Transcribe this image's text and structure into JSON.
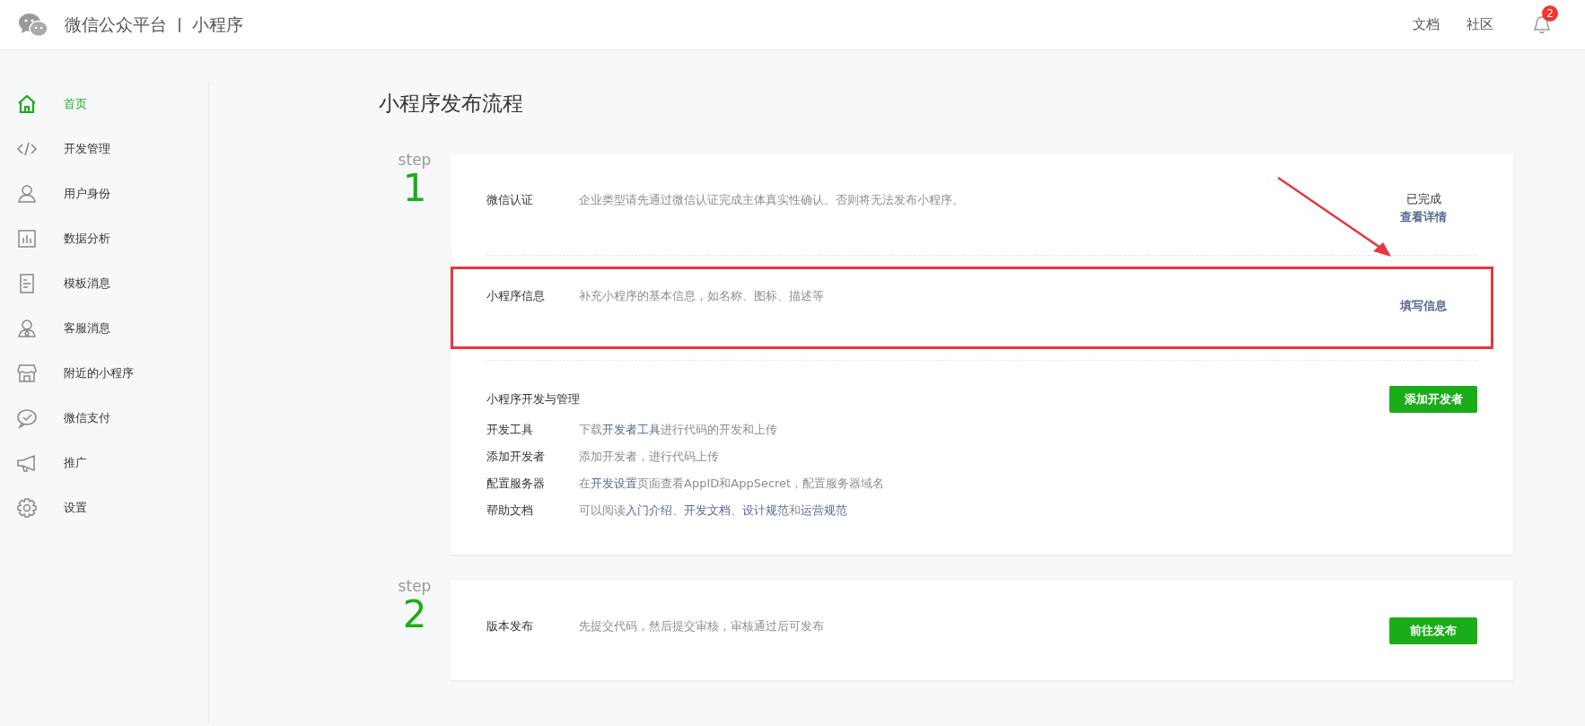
{
  "header": {
    "brand": "微信公众平台",
    "section": "小程序",
    "links": [
      "文档",
      "社区"
    ],
    "notification_count": "2"
  },
  "sidebar": {
    "items": [
      {
        "label": "首页",
        "selected": true
      },
      {
        "label": "开发管理",
        "selected": false
      },
      {
        "label": "用户身份",
        "selected": false
      },
      {
        "label": "数据分析",
        "selected": false
      },
      {
        "label": "模板消息",
        "selected": false
      },
      {
        "label": "客服消息",
        "selected": false
      },
      {
        "label": "附近的小程序",
        "selected": false
      },
      {
        "label": "微信支付",
        "selected": false
      },
      {
        "label": "推广",
        "selected": false
      },
      {
        "label": "设置",
        "selected": false
      }
    ]
  },
  "page_title": "小程序发布流程",
  "steps": [
    {
      "step_label": "step",
      "number": "1",
      "rows": [
        {
          "kind": "task",
          "label": "微信认证",
          "description": "企业类型请先通过微信认证完成主体真实性确认。否则将无法发布小程序。",
          "status": "已完成",
          "link": "查看详情"
        },
        {
          "kind": "task",
          "label": "小程序信息",
          "description": "补充小程序的基本信息，如名称、图标、描述等",
          "link": "填写信息",
          "highlighted": true
        },
        {
          "kind": "section",
          "title": "小程序开发与管理",
          "button": "添加开发者",
          "items": [
            {
              "label": "开发工具",
              "parts": [
                {
                  "text": "下载"
                },
                {
                  "link": "开发者工具"
                },
                {
                  "text": "进行代码的开发和上传"
                }
              ]
            },
            {
              "label": "添加开发者",
              "parts": [
                {
                  "text": "添加开发者，进行代码上传"
                }
              ]
            },
            {
              "label": "配置服务器",
              "parts": [
                {
                  "text": "在"
                },
                {
                  "link": "开发设置"
                },
                {
                  "text": "页面查看AppID和AppSecret，配置服务器域名"
                }
              ]
            },
            {
              "label": "帮助文档",
              "parts": [
                {
                  "text": "可以阅读"
                },
                {
                  "link": "入门介绍"
                },
                {
                  "text": "、"
                },
                {
                  "link": "开发文档"
                },
                {
                  "text": "、"
                },
                {
                  "link": "设计规范"
                },
                {
                  "text": "和"
                },
                {
                  "link": "运营规范"
                }
              ]
            }
          ]
        }
      ]
    },
    {
      "step_label": "step",
      "number": "2",
      "rows": [
        {
          "kind": "task_button",
          "label": "版本发布",
          "description": "先提交代码，然后提交审核，审核通过后可发布",
          "button": "前往发布"
        }
      ]
    }
  ]
}
